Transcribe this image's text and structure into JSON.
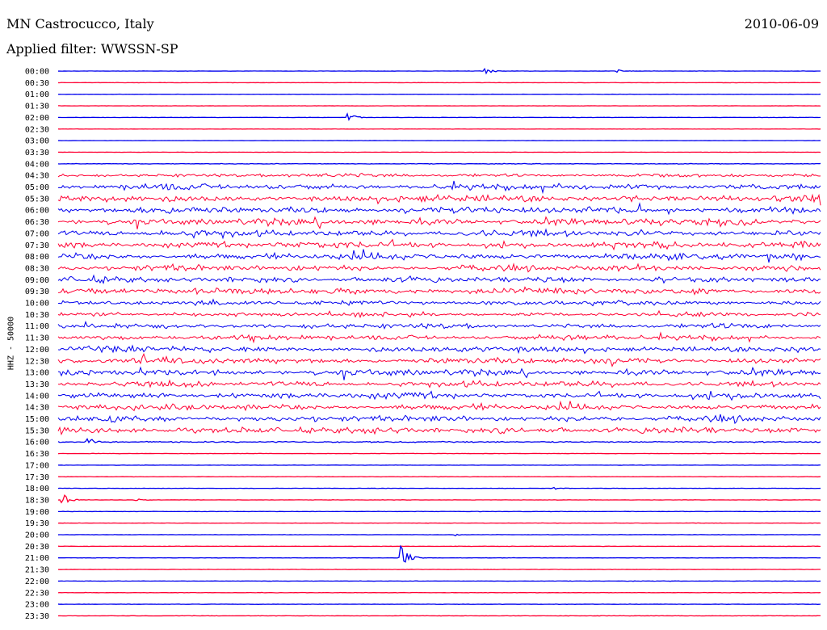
{
  "header": {
    "station": "MN Castrocucco, Italy",
    "date": "2010-06-09",
    "filter": "Applied filter: WWSSN-SP"
  },
  "chart_data": {
    "type": "line",
    "title": "MN Castrocucco, Italy",
    "ylabel": "HHZ - 50000",
    "row_labels": [
      "00:00",
      "00:30",
      "01:00",
      "01:30",
      "02:00",
      "02:30",
      "03:00",
      "03:30",
      "04:00",
      "04:30",
      "05:00",
      "05:30",
      "06:00",
      "06:30",
      "07:00",
      "07:30",
      "08:00",
      "08:30",
      "09:00",
      "09:30",
      "10:00",
      "10:30",
      "11:00",
      "11:30",
      "12:00",
      "12:30",
      "13:00",
      "13:30",
      "14:00",
      "14:30",
      "15:00",
      "15:30",
      "16:00",
      "16:30",
      "17:00",
      "17:30",
      "18:00",
      "18:30",
      "19:00",
      "19:30",
      "20:00",
      "20:30",
      "21:00",
      "21:30",
      "22:00",
      "22:30",
      "23:00",
      "23:30"
    ],
    "trace_colors": [
      "#0000ee",
      "#ff0033"
    ],
    "noise_level": [
      0.25,
      0.25,
      0.2,
      0.25,
      0.3,
      0.25,
      0.2,
      0.25,
      0.5,
      3.0,
      5.0,
      5.5,
      5.5,
      5.5,
      5.5,
      5.5,
      5.5,
      5.0,
      5.0,
      5.5,
      4.0,
      3.5,
      4.0,
      4.5,
      5.0,
      5.0,
      5.0,
      5.0,
      5.0,
      5.0,
      5.0,
      5.5,
      1.0,
      0.3,
      0.3,
      0.3,
      0.3,
      0.3,
      0.3,
      0.3,
      0.3,
      0.3,
      0.3,
      0.3,
      0.3,
      0.3,
      0.3,
      0.3
    ],
    "events": [
      {
        "row": "00:00",
        "x_fraction": 0.56,
        "amplitude": 4
      },
      {
        "row": "00:00",
        "x_fraction": 0.735,
        "amplitude": 2
      },
      {
        "row": "02:00",
        "x_fraction": 0.38,
        "amplitude": 6
      },
      {
        "row": "16:00",
        "x_fraction": 0.04,
        "amplitude": 5
      },
      {
        "row": "18:30",
        "x_fraction": 0.005,
        "amplitude": 10
      },
      {
        "row": "18:30",
        "x_fraction": 0.1,
        "amplitude": 2
      },
      {
        "row": "21:00",
        "x_fraction": 0.445,
        "amplitude": 28
      },
      {
        "row": "18:00",
        "x_fraction": 0.65,
        "amplitude": 2
      },
      {
        "row": "20:00",
        "x_fraction": 0.52,
        "amplitude": 2
      }
    ]
  }
}
